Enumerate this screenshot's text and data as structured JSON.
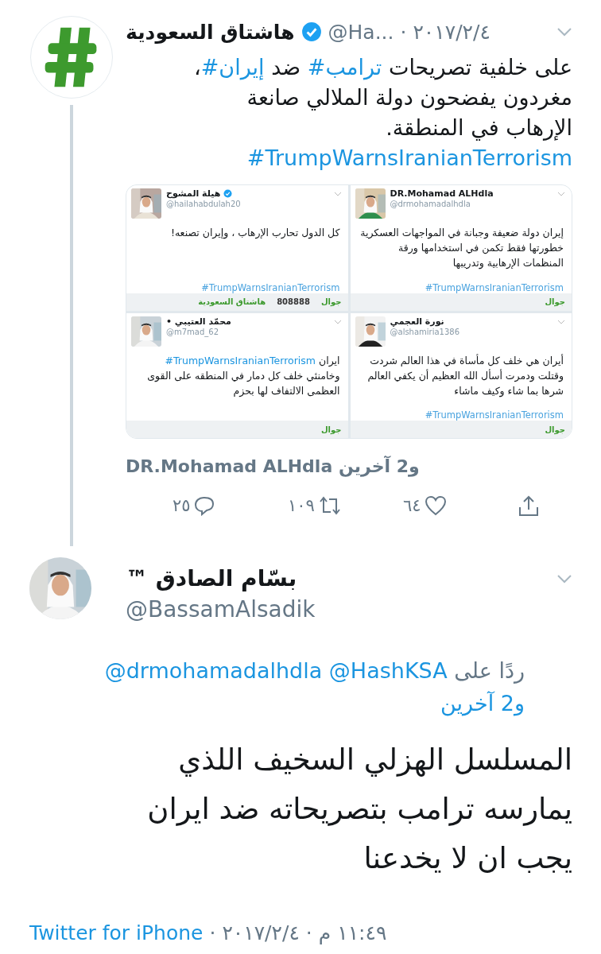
{
  "tweet": {
    "name": "هاشتاق السعودية",
    "verified": true,
    "handle": "@Ha...",
    "separator": "·",
    "date": "٢٠١٧/٢/٤",
    "text": [
      {
        "text": "على خلفية تصريحات ",
        "kind": "plain"
      },
      {
        "text": "#ترامب",
        "kind": "hashtag"
      },
      {
        "text": " ضد ",
        "kind": "plain"
      },
      {
        "text": "#إيران",
        "kind": "hashtag"
      },
      {
        "text": "، مغردون يفضحون دولة الملالي صانعة الإرهاب في المنطقة.",
        "kind": "plain"
      }
    ],
    "tag": "#TrumpWarnsIranianTerrorism",
    "media": [
      {
        "name": "DR.Mohamad ALHdla",
        "verified": false,
        "handle": "@drmohamadalhdla",
        "text": [
          {
            "text": "إيران دولة ضعيفة وجبانة في المواجهات العسكرية خطورتها فقط تكمن في استخدامها ورقة المنظمات الإرهابية وتدريبها",
            "kind": "plain"
          }
        ],
        "tag": "#TrumpWarnsIranianTerrorism",
        "footer": [
          {
            "text": "جوال",
            "kind": "brand"
          }
        ]
      },
      {
        "name": "هيلة المشوح",
        "verified": true,
        "handle": "@hailahabdulah20",
        "text": [
          {
            "text": "كل الدول تحارب الإرهاب ، وإيران تصنعه!",
            "kind": "plain"
          }
        ],
        "tag": "#TrumpWarnsIranianTerrorism",
        "footer": [
          {
            "text": "جوال",
            "kind": "brand"
          },
          {
            "text": "808888",
            "kind": "code"
          },
          {
            "text": "هاشتاق السعودية",
            "kind": "brand"
          }
        ]
      },
      {
        "name": "نورة العجمي",
        "verified": false,
        "handle": "@alshamiria1386",
        "text": [
          {
            "text": "أيران هي خلف كل مأساة في هذا العالم شردت وقتلت ودمرت أسأل الله العظيم أن يكفي العالم شرها بما شاء وكيف ماشاء",
            "kind": "plain"
          }
        ],
        "tag": "#TrumpWarnsIranianTerrorism",
        "footer": [
          {
            "text": "جوال",
            "kind": "brand"
          }
        ]
      },
      {
        "name": "محمّد العتيبي •",
        "verified": false,
        "handle": "@m7mad_62",
        "text": [
          {
            "text": "ايران ",
            "kind": "plain"
          },
          {
            "text": "#TrumpWarnsIranianTerrorism",
            "kind": "hashtag"
          },
          {
            "text": " وخامنئي خلف كل دمار في المنطقه على القوى العظمى الالتفاف لها بحزم",
            "kind": "plain"
          }
        ],
        "footer": [
          {
            "text": "جوال",
            "kind": "brand"
          }
        ]
      }
    ],
    "context": "و2 آخرين DR.Mohamad ALHdla",
    "actions": [
      {
        "kind": "share"
      },
      {
        "kind": "like",
        "count": "٦٤"
      },
      {
        "kind": "retweet",
        "count": "١٠٩"
      },
      {
        "kind": "reply",
        "count": "٢٥"
      }
    ]
  },
  "reply": {
    "name": "بسّام الصادق ™",
    "handle": "@BassamAlsadik",
    "replying_to": [
      {
        "text": "ردًا على ",
        "kind": "plain"
      },
      {
        "text": "@HashKSA",
        "kind": "mention"
      },
      {
        "text": "@drmohamadalhdla",
        "kind": "mention"
      },
      {
        "text": "و2 آخرين",
        "kind": "mention"
      }
    ],
    "text": "المسلسل الهزلي السخيف اللذي يمارسه ترامب بتصريحاته ضد ايران يجب ان لا يخدعنا",
    "footer": {
      "time": "١١:٤٩ م",
      "separator": "·",
      "date": "٢٠١٧/٢/٤",
      "source": "Twitter for iPhone"
    }
  }
}
